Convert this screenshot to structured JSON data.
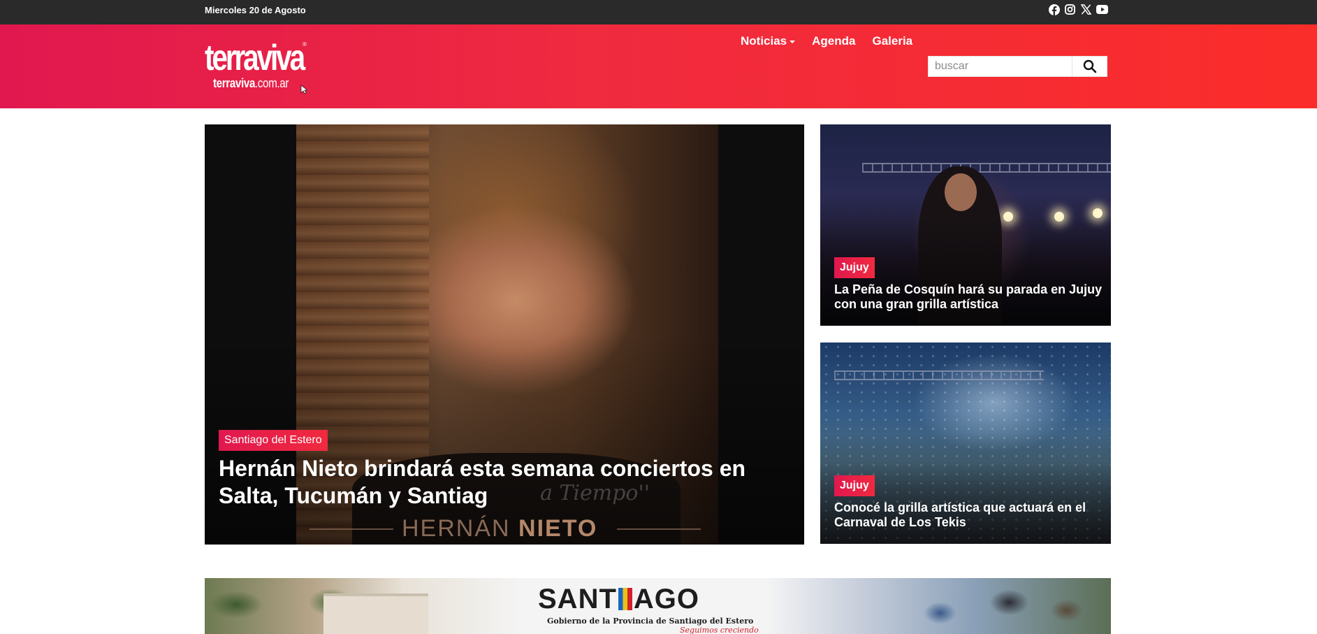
{
  "topbar": {
    "date": "Miercoles 20 de Agosto",
    "social": [
      "facebook-icon",
      "instagram-icon",
      "x-icon",
      "youtube-icon"
    ]
  },
  "header": {
    "logo_main": "terraviva",
    "logo_domain_a": "terraviva",
    "logo_domain_b": ".com.ar",
    "logo_reg": "®",
    "nav": {
      "noticias": "Noticias",
      "agenda": "Agenda",
      "galeria": "Galeria"
    },
    "search": {
      "placeholder": "buscar"
    }
  },
  "hero": {
    "tag": "Santiago del Estero",
    "title": "Hernán Nieto brindará esta semana conciertos en Salta, Tucumán y Santiag",
    "watermark_script": "a Tiempo''",
    "watermark_first": "HERNÁN ",
    "watermark_last": "NIETO"
  },
  "side_cards": [
    {
      "tag": "Jujuy",
      "title": "La Peña de Cosquín hará su parada en Jujuy con una gran grilla artística"
    },
    {
      "tag": "Jujuy",
      "title": "Conocé la grilla artística que actuará en el Carnaval de Los Tekis"
    }
  ],
  "banner": {
    "brand_a": "SANT",
    "brand_b": "AGO",
    "subtitle": "Gobierno de la Provincia de Santiago del Estero",
    "slogan": "Seguimos creciendo"
  },
  "colors": {
    "accent": "#f02a3f",
    "accent_start": "#e0184f",
    "topbar": "#2a2a2a"
  }
}
